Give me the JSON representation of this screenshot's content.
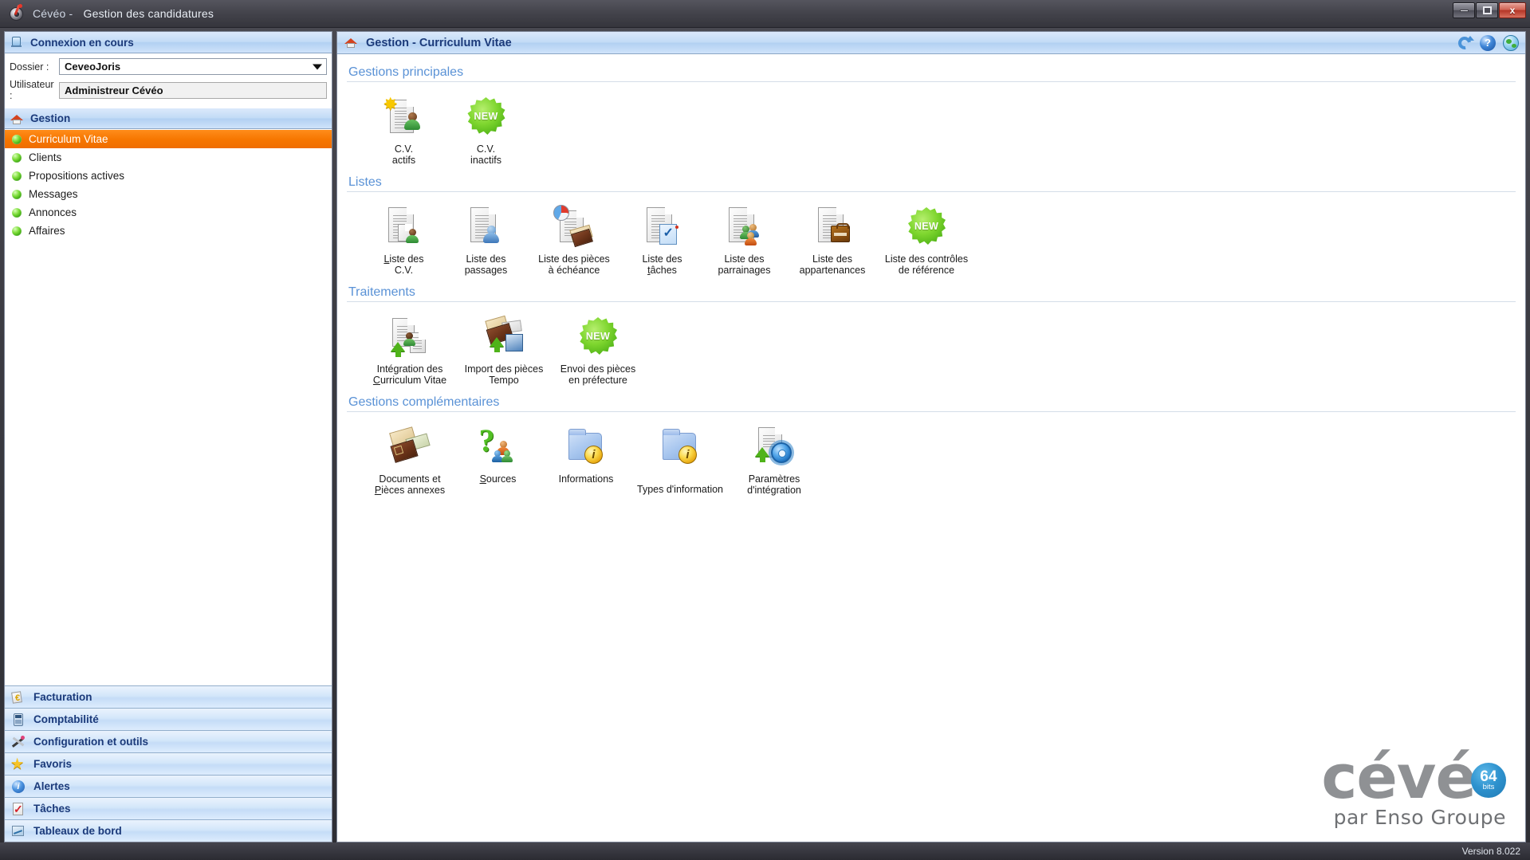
{
  "window": {
    "app_name": "Cévéo - ",
    "title": "Gestion des candidatures",
    "logo_icon": "ceveo-target-icon",
    "controls": {
      "minimize": "minimize-button",
      "maximize": "maximize-button",
      "close": "close-button",
      "close_glyph": "x"
    }
  },
  "connection": {
    "header": "Connexion en cours",
    "header_icon": "database-icon",
    "dossier_label": "Dossier :",
    "dossier_value": "CeveoJoris",
    "utilisateur_label": "Utilisateur :",
    "utilisateur_value": "Administreur Cévéo"
  },
  "sidebar": {
    "gestion_header": "Gestion",
    "gestion_header_icon": "home-icon",
    "items": [
      {
        "label": "Curriculum Vitae",
        "active": true
      },
      {
        "label": "Clients",
        "active": false
      },
      {
        "label": "Propositions actives",
        "active": false
      },
      {
        "label": "Messages",
        "active": false
      },
      {
        "label": "Annonces",
        "active": false
      },
      {
        "label": "Affaires",
        "active": false
      }
    ],
    "modules": [
      {
        "label": "Facturation",
        "icon": "euro-invoice-icon"
      },
      {
        "label": "Comptabilité",
        "icon": "calculator-icon"
      },
      {
        "label": "Configuration et outils",
        "icon": "tools-icon"
      },
      {
        "label": "Favoris",
        "icon": "star-icon"
      },
      {
        "label": "Alertes",
        "icon": "info-circle-icon"
      },
      {
        "label": "Tâches",
        "icon": "checklist-icon"
      },
      {
        "label": "Tableaux de bord",
        "icon": "chart-board-icon"
      }
    ]
  },
  "main": {
    "title": "Gestion - Curriculum Vitae",
    "title_icon": "home-icon",
    "header_icons": [
      {
        "name": "refresh-icon"
      },
      {
        "name": "help-icon"
      },
      {
        "name": "globe-icon"
      }
    ],
    "sections": [
      {
        "title": "Gestions principales",
        "items": [
          {
            "label_lines": [
              "C.V.",
              "actifs"
            ],
            "icon": "cv-active-icon"
          },
          {
            "label_lines": [
              "C.V.",
              "inactifs"
            ],
            "icon": "new-badge-icon"
          }
        ]
      },
      {
        "title": "Listes",
        "items": [
          {
            "label_lines": [
              "Liste des",
              "C.V."
            ],
            "accel": "L",
            "icon": "list-cv-icon"
          },
          {
            "label_lines": [
              "Liste des",
              "passages"
            ],
            "accel": "g",
            "icon": "list-passages-icon"
          },
          {
            "label_lines": [
              "Liste des pièces",
              "à échéance"
            ],
            "icon": "list-echeance-icon"
          },
          {
            "label_lines": [
              "Liste des",
              "tâches"
            ],
            "accel": "t",
            "icon": "list-taches-icon"
          },
          {
            "label_lines": [
              "Liste des",
              "parrainages"
            ],
            "icon": "list-parrainages-icon"
          },
          {
            "label_lines": [
              "Liste des",
              "appartenances"
            ],
            "icon": "list-appartenances-icon"
          },
          {
            "label_lines": [
              "Liste des contrôles",
              "de référence"
            ],
            "icon": "new-badge-icon"
          }
        ]
      },
      {
        "title": "Traitements",
        "items": [
          {
            "label_lines": [
              "Intégration des",
              "Curriculum Vitae"
            ],
            "accel": "C",
            "icon": "integration-cv-icon"
          },
          {
            "label_lines": [
              "Import des pièces",
              "Tempo"
            ],
            "icon": "import-tempo-icon"
          },
          {
            "label_lines": [
              "Envoi des pièces",
              "en préfecture"
            ],
            "icon": "new-badge-icon"
          }
        ]
      },
      {
        "title": "Gestions complémentaires",
        "items": [
          {
            "label_lines": [
              "Documents et",
              "Pièces annexes"
            ],
            "accel": "P",
            "icon": "documents-annexes-icon"
          },
          {
            "label_lines": [
              "Sources"
            ],
            "accel": "S",
            "icon": "sources-icon"
          },
          {
            "label_lines": [
              "Informations"
            ],
            "icon": "informations-folder-icon"
          },
          {
            "label_lines": [
              "Types d'information"
            ],
            "icon": "types-information-folder-icon",
            "drop": true
          },
          {
            "label_lines": [
              "Paramètres",
              "d'intégration"
            ],
            "icon": "parametres-integration-icon"
          }
        ]
      }
    ]
  },
  "watermark": {
    "word": "cévé",
    "badge_number": "64",
    "badge_unit": "bits",
    "tagline": "par Enso Groupe"
  },
  "statusbar": {
    "version": "Version  8.022"
  },
  "colors": {
    "accent_orange": "#f67600",
    "header_blue": "#1b3a7a",
    "section_blue": "#5a92d6",
    "badge_green": "#7fd62f",
    "badge_cyan": "#2f93cf"
  }
}
